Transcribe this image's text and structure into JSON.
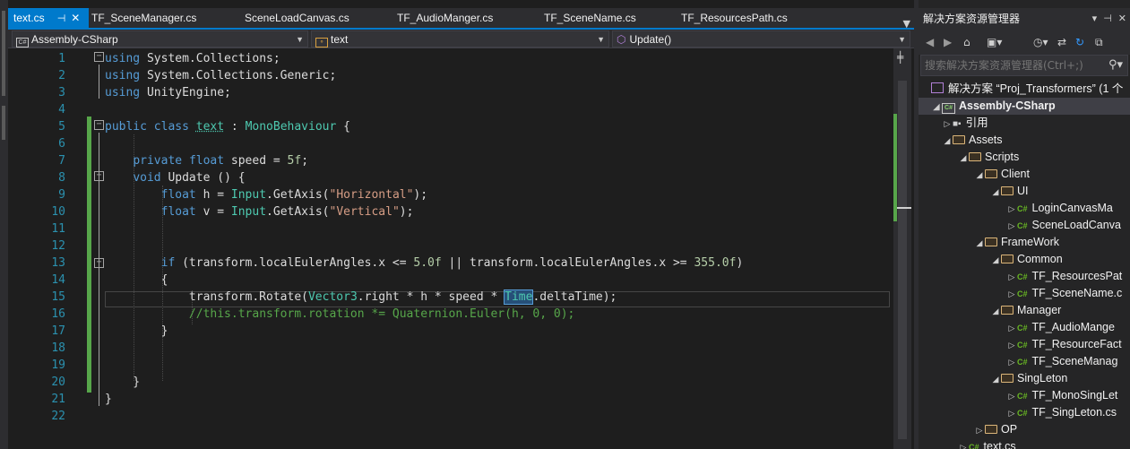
{
  "tabs": [
    {
      "label": "text.cs",
      "active": true,
      "pinned": true
    },
    {
      "label": "TF_SceneManager.cs",
      "active": false
    },
    {
      "label": "SceneLoadCanvas.cs",
      "active": false
    },
    {
      "label": "TF_AudioManger.cs",
      "active": false
    },
    {
      "label": "TF_SceneName.cs",
      "active": false
    },
    {
      "label": "TF_ResourcesPath.cs",
      "active": false
    }
  ],
  "navbar": {
    "project": "Assembly-CSharp",
    "type": "text",
    "member": "Update()"
  },
  "code_lines": [
    {
      "n": "1"
    },
    {
      "n": "2"
    },
    {
      "n": "3"
    },
    {
      "n": "4"
    },
    {
      "n": "5"
    },
    {
      "n": "6"
    },
    {
      "n": "7"
    },
    {
      "n": "8"
    },
    {
      "n": "9"
    },
    {
      "n": "10"
    },
    {
      "n": "11"
    },
    {
      "n": "12"
    },
    {
      "n": "13"
    },
    {
      "n": "14"
    },
    {
      "n": "15"
    },
    {
      "n": "16"
    },
    {
      "n": "17"
    },
    {
      "n": "18"
    },
    {
      "n": "19"
    },
    {
      "n": "20"
    },
    {
      "n": "21"
    },
    {
      "n": "22"
    }
  ],
  "code": {
    "l1": {
      "a": "using",
      "b": " System.Collections;"
    },
    "l2": {
      "a": "using",
      "b": " System.Collections.Generic;"
    },
    "l3": {
      "a": "using",
      "b": " UnityEngine;"
    },
    "l5": {
      "a": "public",
      "b": " ",
      "c": "class",
      "d": " ",
      "e": "text",
      "f": " : ",
      "g": "MonoBehaviour",
      "h": " {"
    },
    "l7": {
      "a": "    ",
      "b": "private",
      "c": " ",
      "d": "float",
      "e": " speed = ",
      "f": "5f",
      "g": ";"
    },
    "l8": {
      "a": "    ",
      "b": "void",
      "c": " Update () {"
    },
    "l9": {
      "a": "        ",
      "b": "float",
      "c": " h = ",
      "d": "Input",
      "e": ".GetAxis(",
      "f": "\"Horizontal\"",
      "g": ");"
    },
    "l10": {
      "a": "        ",
      "b": "float",
      "c": " v = ",
      "d": "Input",
      "e": ".GetAxis(",
      "f": "\"Vertical\"",
      "g": ");"
    },
    "l13": {
      "a": "        ",
      "b": "if",
      "c": " (transform.localEulerAngles.x <= ",
      "d": "5.0f",
      "e": " || transform.localEulerAngles.x >= ",
      "f": "355.0f",
      "g": ")"
    },
    "l14": {
      "a": "        {"
    },
    "l15": {
      "a": "            transform.Rotate(",
      "b": "Vector3",
      "c": ".right * h * speed * ",
      "d": "Time",
      "e": ".deltaTime);"
    },
    "l16": {
      "a": "            ",
      "b": "//this.transform.rotation *= Quaternion.Euler(h, 0, 0);"
    },
    "l17": {
      "a": "        }"
    },
    "l20": {
      "a": "    }"
    },
    "l21": {
      "a": "}"
    }
  },
  "solution_explorer": {
    "title": "解决方案资源管理器",
    "search_placeholder": "搜索解决方案资源管理器(Ctrl+;)",
    "tree": [
      {
        "label": "解决方案 “Proj_Transformers” (1 个",
        "kind": "solution"
      },
      {
        "label": "Assembly-CSharp",
        "kind": "project",
        "selected": true
      },
      {
        "label": "引用",
        "kind": "references"
      },
      {
        "label": "Assets",
        "kind": "folder"
      },
      {
        "label": "Scripts",
        "kind": "folder"
      },
      {
        "label": "Client",
        "kind": "folder"
      },
      {
        "label": "UI",
        "kind": "folder"
      },
      {
        "label": "LoginCanvasMa",
        "kind": "cs"
      },
      {
        "label": "SceneLoadCanva",
        "kind": "cs"
      },
      {
        "label": "FrameWork",
        "kind": "folder"
      },
      {
        "label": "Common",
        "kind": "folder"
      },
      {
        "label": "TF_ResourcesPat",
        "kind": "cs"
      },
      {
        "label": "TF_SceneName.c",
        "kind": "cs"
      },
      {
        "label": "Manager",
        "kind": "folder"
      },
      {
        "label": "TF_AudioMange",
        "kind": "cs"
      },
      {
        "label": "TF_ResourceFact",
        "kind": "cs"
      },
      {
        "label": "TF_SceneManag",
        "kind": "cs"
      },
      {
        "label": "SingLeton",
        "kind": "folder"
      },
      {
        "label": "TF_MonoSingLet",
        "kind": "cs"
      },
      {
        "label": "TF_SingLeton.cs",
        "kind": "cs"
      },
      {
        "label": "OP",
        "kind": "folder"
      },
      {
        "label": "text.cs",
        "kind": "cs"
      }
    ]
  },
  "colors": {
    "accent": "#007acc",
    "keyword": "#569cd6",
    "type": "#4ec9b0",
    "string": "#d69d85",
    "number": "#b5cea8",
    "comment": "#57a64a",
    "line_number": "#2b91af"
  },
  "icons": [
    "pin-icon",
    "close-icon",
    "tab-overflow-icon",
    "project-icon",
    "class-icon",
    "method-icon",
    "dropdown-arrow-icon",
    "split-icon",
    "back-icon",
    "forward-icon",
    "home-icon",
    "history-icon",
    "sync-icon",
    "refresh-icon",
    "collapse-icon",
    "search-icon",
    "folder-icon",
    "csharp-file-icon",
    "solution-icon",
    "references-icon",
    "expand-arrow-icon",
    "collapse-arrow-icon"
  ]
}
